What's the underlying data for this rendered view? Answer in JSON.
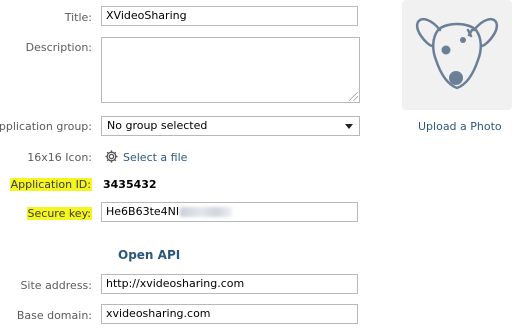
{
  "form": {
    "title_label": "Title:",
    "title_value": "XVideoSharing",
    "description_label": "Description:",
    "description_value": "",
    "group_label": "Application group:",
    "group_value": "No group selected",
    "icon_label": "16x16 Icon:",
    "icon_link": "Select a file",
    "appid_label": "Application ID:",
    "appid_value": "3435432",
    "secret_label": "Secure key:",
    "secret_value_visible": "He6B63te4NI",
    "open_api_heading": "Open API",
    "site_label": "Site address:",
    "site_value": "http://xvideosharing.com",
    "domain_label": "Base domain:",
    "domain_value": "xvideosharing.com"
  },
  "photo": {
    "upload_link": "Upload a Photo",
    "placeholder_icon": "dog-avatar-icon"
  },
  "colors": {
    "link": "#2b587a",
    "highlight": "#f5f51f",
    "label": "#5b5b5b",
    "border": "#b8b8b8"
  }
}
